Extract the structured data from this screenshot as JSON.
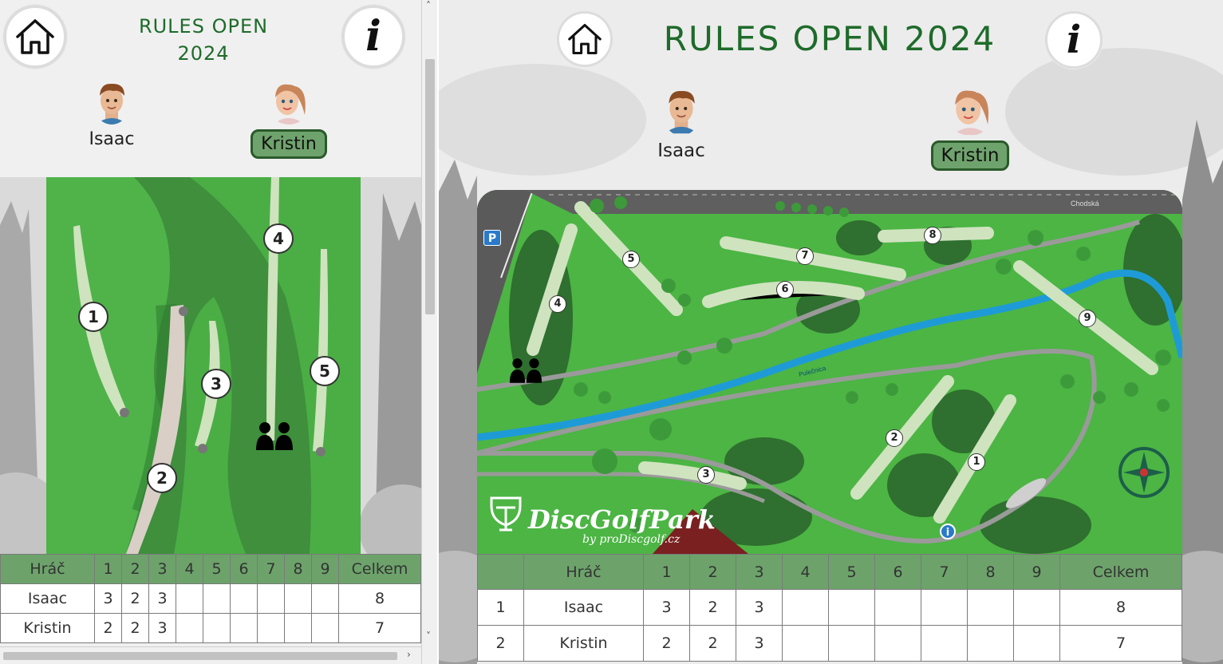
{
  "event": {
    "title": "RULES OPEN 2024",
    "title_line1": "RULES OPEN",
    "title_line2": "2024"
  },
  "icons": {
    "home": "home-icon",
    "info": "info-icon"
  },
  "info_glyph": "i",
  "players": [
    {
      "name": "Isaac",
      "active": false
    },
    {
      "name": "Kristin",
      "active": true
    }
  ],
  "map": {
    "mobile_holes": [
      "1",
      "2",
      "3",
      "4",
      "5"
    ],
    "desktop_holes": [
      "1",
      "2",
      "3",
      "4",
      "5",
      "6",
      "7",
      "8",
      "9"
    ],
    "street_label": "Chodská",
    "river_label": "Pulečnica",
    "parking_label": "P",
    "info_marker": "i",
    "logo": "DiscGolfPark",
    "logo_sub": "by proDiscgolf.cz"
  },
  "scoreboard": {
    "headers": {
      "player": "Hráč",
      "holes": [
        "1",
        "2",
        "3",
        "4",
        "5",
        "6",
        "7",
        "8",
        "9"
      ],
      "total": "Celkem"
    },
    "rows": [
      {
        "rank": "1",
        "name": "Isaac",
        "scores": [
          "3",
          "2",
          "3",
          "",
          "",
          "",
          "",
          "",
          ""
        ],
        "total": "8"
      },
      {
        "rank": "2",
        "name": "Kristin",
        "scores": [
          "2",
          "2",
          "3",
          "",
          "",
          "",
          "",
          "",
          ""
        ],
        "total": "7"
      }
    ]
  },
  "colors": {
    "title_green": "#1e6b2a",
    "header_green": "#6da36b",
    "grass": "#4cb544",
    "dark_grass": "#2f6f2f",
    "river": "#1e9bd7"
  }
}
